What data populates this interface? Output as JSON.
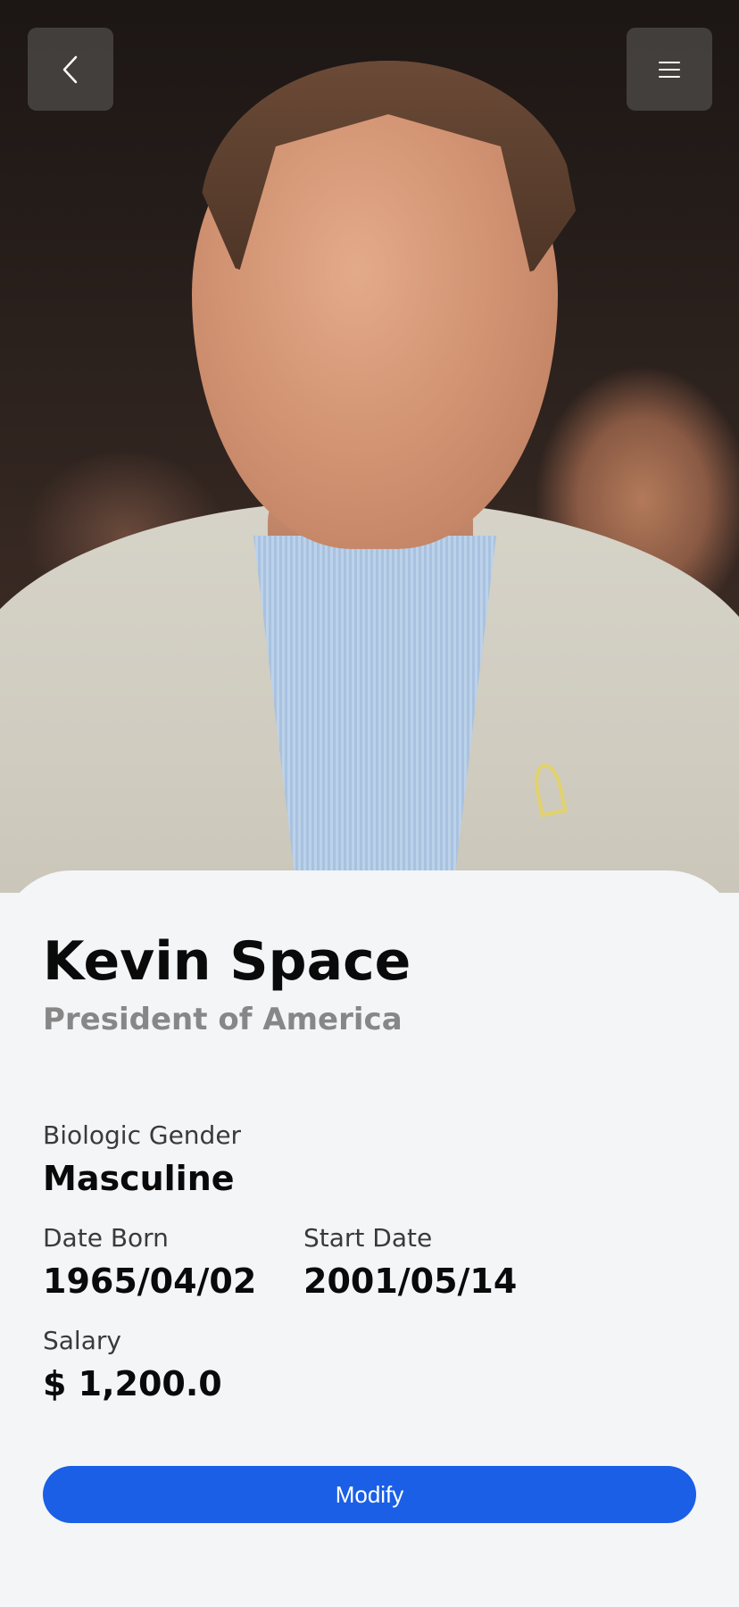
{
  "header": {
    "back_icon": "chevron-left-icon",
    "menu_icon": "hamburger-menu-icon"
  },
  "profile": {
    "name": "Kevin Space",
    "title": "President of America"
  },
  "details": {
    "gender_label": "Biologic Gender",
    "gender_value": "Masculine",
    "date_born_label": "Date Born",
    "date_born_value": "1965/04/02",
    "start_date_label": "Start Date",
    "start_date_value": "2001/05/14",
    "salary_label": "Salary",
    "salary_value": "$ 1,200.0"
  },
  "actions": {
    "modify_label": "Modify"
  },
  "colors": {
    "accent": "#1a5fe6",
    "background": "#f4f5f7",
    "subtitle": "#878787",
    "header_button": "#484442"
  }
}
